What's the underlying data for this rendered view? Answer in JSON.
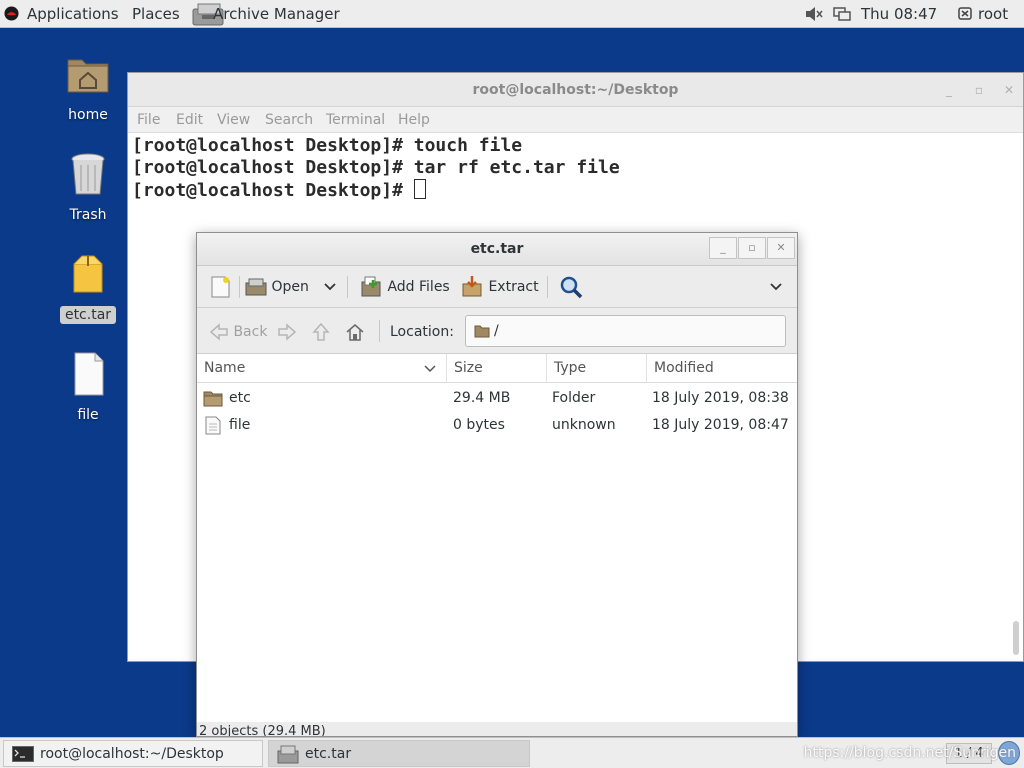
{
  "top_panel": {
    "applications": "Applications",
    "places": "Places",
    "active_app": "Archive Manager",
    "clock": "Thu 08:47",
    "user": "root"
  },
  "desktop": {
    "icons": [
      {
        "label": "home",
        "icon": "home-folder-icon"
      },
      {
        "label": "Trash",
        "icon": "trash-icon"
      },
      {
        "label": "etc.tar",
        "icon": "archive-icon"
      },
      {
        "label": "file",
        "icon": "document-icon"
      }
    ]
  },
  "terminal": {
    "title": "root@localhost:~/Desktop",
    "menu": [
      "File",
      "Edit",
      "View",
      "Search",
      "Terminal",
      "Help"
    ],
    "lines": [
      "[root@localhost Desktop]# touch file",
      "[root@localhost Desktop]# tar rf etc.tar file",
      "[root@localhost Desktop]# "
    ]
  },
  "archive_manager": {
    "title": "etc.tar",
    "toolbar": {
      "open_label": "Open",
      "add_files_label": "Add Files",
      "extract_label": "Extract"
    },
    "nav": {
      "back_label": "Back",
      "location_label": "Location:",
      "location_value": "/"
    },
    "columns": {
      "name": "Name",
      "size": "Size",
      "type": "Type",
      "modified": "Modified"
    },
    "rows": [
      {
        "name": "etc",
        "size": "29.4 MB",
        "type": "Folder",
        "modified": "18 July 2019, 08:38",
        "icon": "folder-icon"
      },
      {
        "name": "file",
        "size": "0 bytes",
        "type": "unknown",
        "modified": "18 July 2019, 08:47",
        "icon": "document-icon"
      }
    ],
    "status": "2 objects (29.4 MB)"
  },
  "taskbar": {
    "tasks": [
      {
        "label": "root@localhost:~/Desktop",
        "icon": "terminal-icon"
      },
      {
        "label": "etc.tar",
        "icon": "archive-manager-icon"
      }
    ],
    "workspace": "1 / 4",
    "watermark": "https://blog.csdn.net/Sunrigen"
  },
  "colors": {
    "desktop_bg": "#0b3a8a",
    "panel_bg": "#ededed"
  }
}
